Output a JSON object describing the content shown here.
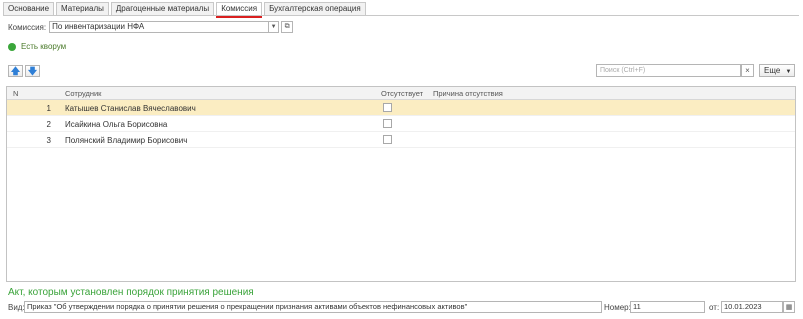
{
  "tabs": [
    {
      "label": "Основание"
    },
    {
      "label": "Материалы"
    },
    {
      "label": "Драгоценные материалы"
    },
    {
      "label": "Комиссия"
    },
    {
      "label": "Бухгалтерская операция"
    }
  ],
  "commission": {
    "label": "Комиссия:",
    "value": "По инвентаризации НФА"
  },
  "quorum": {
    "text": "Есть кворум",
    "color": "#3aa63a"
  },
  "toolbar": {
    "up_icon": "arrow-up-icon",
    "down_icon": "arrow-down-icon"
  },
  "search": {
    "placeholder": "Поиск (Ctrl+F)",
    "clear": "×"
  },
  "more_label": "Еще",
  "table": {
    "columns": [
      "N",
      "Сотрудник",
      "Отсутствует",
      "Причина отсутствия"
    ],
    "rows": [
      {
        "n": "1",
        "employee": "Катышев Станислав Вячеславович",
        "absent": false,
        "reason": ""
      },
      {
        "n": "2",
        "employee": "Исайкина Ольга Борисовна",
        "absent": false,
        "reason": ""
      },
      {
        "n": "3",
        "employee": "Полянский Владимир Борисович",
        "absent": false,
        "reason": ""
      }
    ]
  },
  "act": {
    "title": "Акт, которым установлен порядок принятия решения",
    "kind_label": "Вид:",
    "kind_value": "Приказ \"Об утверждении порядка о принятии решения о прекращении признания активами объектов нефинансовых активов\"",
    "number_label": "Номер:",
    "number_value": "11",
    "date_label": "от:",
    "date_value": "10.01.2023"
  },
  "colors": {
    "selected_row": "#fbedc2",
    "accent_green": "#3aa33a",
    "active_tab_underline": "#d92020",
    "arrow_blue": "#2f7fd6"
  }
}
